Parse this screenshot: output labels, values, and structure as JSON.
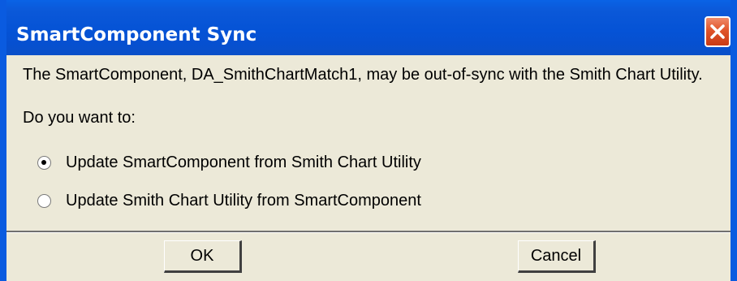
{
  "window": {
    "title": "SmartComponent Sync",
    "close_icon": "close-x-icon",
    "colors": {
      "titlebar": "#0553D6",
      "close_button": "#E0542A",
      "dialog_face": "#ECE9D8"
    }
  },
  "message": "The SmartComponent, DA_SmithChartMatch1, may be out-of-sync with the Smith Chart Utility.",
  "prompt": "Do you want to:",
  "options": [
    {
      "label": "Update SmartComponent from Smith Chart Utility",
      "selected": true
    },
    {
      "label": "Update Smith Chart Utility from SmartComponent",
      "selected": false
    }
  ],
  "buttons": {
    "ok_label": "OK",
    "cancel_label": "Cancel"
  }
}
